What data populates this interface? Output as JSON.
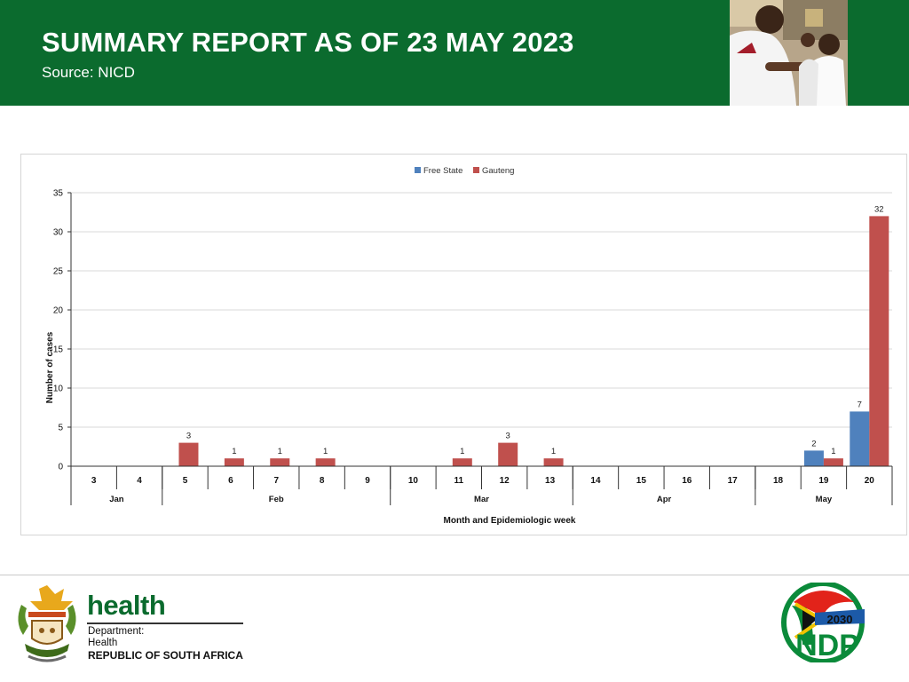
{
  "header": {
    "title": "SUMMARY REPORT AS OF 23 MAY 2023",
    "subtitle": "Source: NICD",
    "photo_icon": "nurse-vaccinating-child-photo"
  },
  "colors": {
    "header_bg": "#0b6b2e",
    "free_state": "#4f81bd",
    "gauteng": "#c0504d",
    "grid": "#d9d9d9"
  },
  "chart_data": {
    "type": "bar",
    "xlabel": "Month and Epidemiologic week",
    "ylabel": "Number of cases",
    "ylim": [
      0,
      35
    ],
    "yticks": [
      0,
      5,
      10,
      15,
      20,
      25,
      30,
      35
    ],
    "grid": true,
    "legend_position": "top-center",
    "categories": [
      "3",
      "4",
      "5",
      "6",
      "7",
      "8",
      "9",
      "10",
      "11",
      "12",
      "13",
      "14",
      "15",
      "16",
      "17",
      "18",
      "19",
      "20"
    ],
    "months": [
      {
        "label": "Jan",
        "weeks": [
          "3",
          "4"
        ]
      },
      {
        "label": "Feb",
        "weeks": [
          "5",
          "6",
          "7",
          "8",
          "9"
        ]
      },
      {
        "label": "Mar",
        "weeks": [
          "10",
          "11",
          "12",
          "13"
        ]
      },
      {
        "label": "Apr",
        "weeks": [
          "14",
          "15",
          "16",
          "17"
        ]
      },
      {
        "label": "May",
        "weeks": [
          "18",
          "19",
          "20"
        ]
      }
    ],
    "series": [
      {
        "name": "Free State",
        "color": "#4f81bd",
        "values": [
          0,
          0,
          0,
          0,
          0,
          0,
          0,
          0,
          0,
          0,
          0,
          0,
          0,
          0,
          0,
          0,
          2,
          7
        ]
      },
      {
        "name": "Gauteng",
        "color": "#c0504d",
        "values": [
          0,
          0,
          3,
          1,
          1,
          1,
          0,
          0,
          1,
          3,
          1,
          0,
          0,
          0,
          0,
          0,
          1,
          32
        ]
      }
    ]
  },
  "footer": {
    "crest_icon": "south-africa-coat-of-arms-icon",
    "health_word": "health",
    "dept_line1": "Department:",
    "dept_line2": "Health",
    "dept_line3": "REPUBLIC OF SOUTH AFRICA",
    "ndp_year": "2030",
    "ndp_text": "NDP"
  }
}
